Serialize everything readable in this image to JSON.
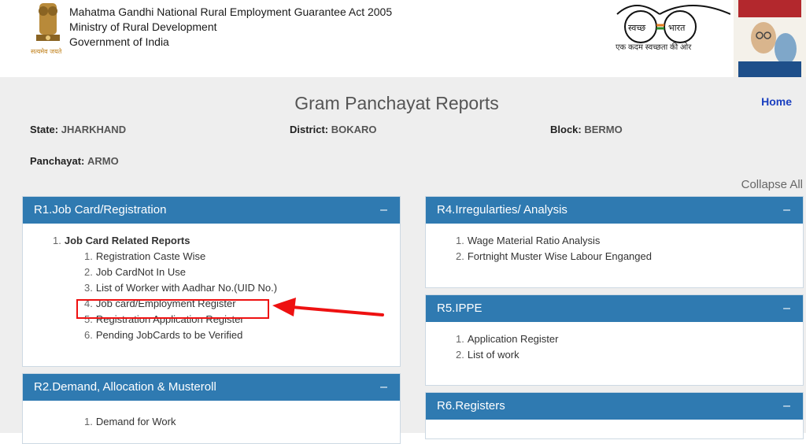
{
  "header": {
    "org_line1": "Mahatma Gandhi National Rural Employment Guarantee Act 2005",
    "org_line2": "Ministry of Rural Development",
    "org_line3": "Government of India",
    "emblem_motto": "सत्यमेव जयते",
    "swachh_word1": "स्वच्छ",
    "swachh_word2": "भारत",
    "swachh_caption": "एक कदम स्वच्छता की ओर"
  },
  "page": {
    "title": "Gram Panchayat Reports",
    "home_label": "Home",
    "collapse_all": "Collapse All"
  },
  "meta": {
    "state_label": "State:",
    "state_value": "JHARKHAND",
    "district_label": "District:",
    "district_value": "BOKARO",
    "block_label": "Block:",
    "block_value": "BERMO",
    "panchayat_label": "Panchayat:",
    "panchayat_value": "ARMO"
  },
  "panels": {
    "r1": {
      "title": "R1.Job Card/Registration",
      "toggle": "–",
      "group_num": "1.",
      "group_title": "Job Card Related Reports",
      "items": [
        {
          "num": "1.",
          "label": "Registration Caste Wise"
        },
        {
          "num": "2.",
          "label": "Job CardNot In Use"
        },
        {
          "num": "3.",
          "label": "List of Worker with Aadhar No.(UID No.)"
        },
        {
          "num": "4.",
          "label": "Job card/Employment Register"
        },
        {
          "num": "5.",
          "label": "Registration Application Register"
        },
        {
          "num": "6.",
          "label": "Pending JobCards to be Verified"
        }
      ]
    },
    "r2": {
      "title": "R2.Demand, Allocation & Musteroll",
      "toggle": "–",
      "items": [
        {
          "num": "1.",
          "label": "Demand for Work"
        }
      ]
    },
    "r4": {
      "title": "R4.Irregularties/ Analysis",
      "toggle": "–",
      "items": [
        {
          "num": "1.",
          "label": "Wage Material Ratio Analysis"
        },
        {
          "num": "2.",
          "label": "Fortnight Muster Wise Labour Enganged"
        }
      ]
    },
    "r5": {
      "title": "R5.IPPE",
      "toggle": "–",
      "items": [
        {
          "num": "1.",
          "label": "Application Register"
        },
        {
          "num": "2.",
          "label": "List of work"
        }
      ]
    },
    "r6": {
      "title": "R6.Registers",
      "toggle": "–"
    }
  },
  "colors": {
    "panel_header": "#2f7ab1",
    "annotation_red": "#ee1111",
    "home_link": "#1a3fc0"
  }
}
